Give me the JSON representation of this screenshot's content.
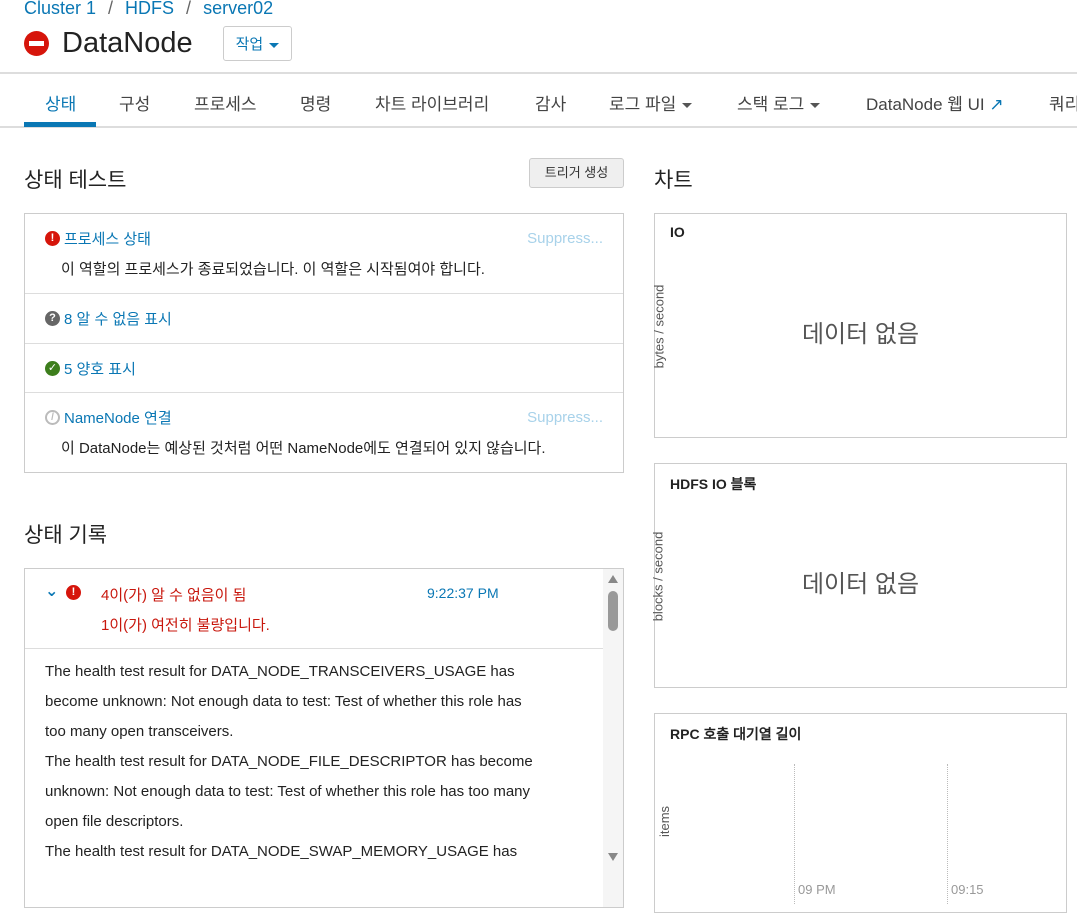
{
  "breadcrumb": [
    "Cluster 1",
    "HDFS",
    "server02"
  ],
  "title": "DataNode",
  "actions_label": "작업",
  "tabs": [
    "상태",
    "구성",
    "프로세스",
    "명령",
    "차트 라이브러리",
    "감사",
    "로그 파일",
    "스택 로그",
    "DataNode 웹 UI",
    "쿼리"
  ],
  "health": {
    "title": "상태 테스트",
    "trigger_label": "트리거 생성",
    "tests": [
      {
        "label": "프로세스 상태",
        "desc": "이 역할의 프로세스가 종료되었습니다. 이 역할은 시작됨여야 합니다.",
        "suppress": "Suppress...",
        "status": "bad"
      },
      {
        "label": "8 알 수 없음 표시",
        "status": "unknown"
      },
      {
        "label": "5 양호 표시",
        "status": "good"
      },
      {
        "label": "NameNode 연결",
        "desc": "이 DataNode는 예상된 것처럼 어떤 NameNode에도 연결되어 있지 않습니다.",
        "suppress": "Suppress...",
        "status": "disabled"
      }
    ]
  },
  "history": {
    "title": "상태 기록",
    "line1": "4이(가) 알 수 없음이 됨",
    "line2": "1이(가) 여전히 불량입니다.",
    "time": "9:22:37 PM",
    "body": [
      "The health test result for DATA_NODE_TRANSCEIVERS_USAGE has",
      "become unknown: Not enough data to test: Test of whether this role has",
      "too many open transceivers.",
      "The health test result for DATA_NODE_FILE_DESCRIPTOR has become",
      "unknown: Not enough data to test: Test of whether this role has too many",
      "open file descriptors.",
      "The health test result for DATA_NODE_SWAP_MEMORY_USAGE has"
    ]
  },
  "charts": {
    "title": "차트",
    "items": [
      {
        "title": "IO",
        "ylabel": "bytes / second",
        "nodata": "데이터 없음"
      },
      {
        "title": "HDFS IO 블록",
        "ylabel": "blocks / second",
        "nodata": "데이터 없음"
      },
      {
        "title": "RPC 호출 대기열 길이",
        "ylabel": "items",
        "xticks": [
          "09 PM",
          "09:15"
        ]
      }
    ]
  },
  "colors": {
    "accent": "#0a77b4",
    "bad": "#d6150b",
    "good": "#3d7e1c",
    "unknown": "#666"
  }
}
